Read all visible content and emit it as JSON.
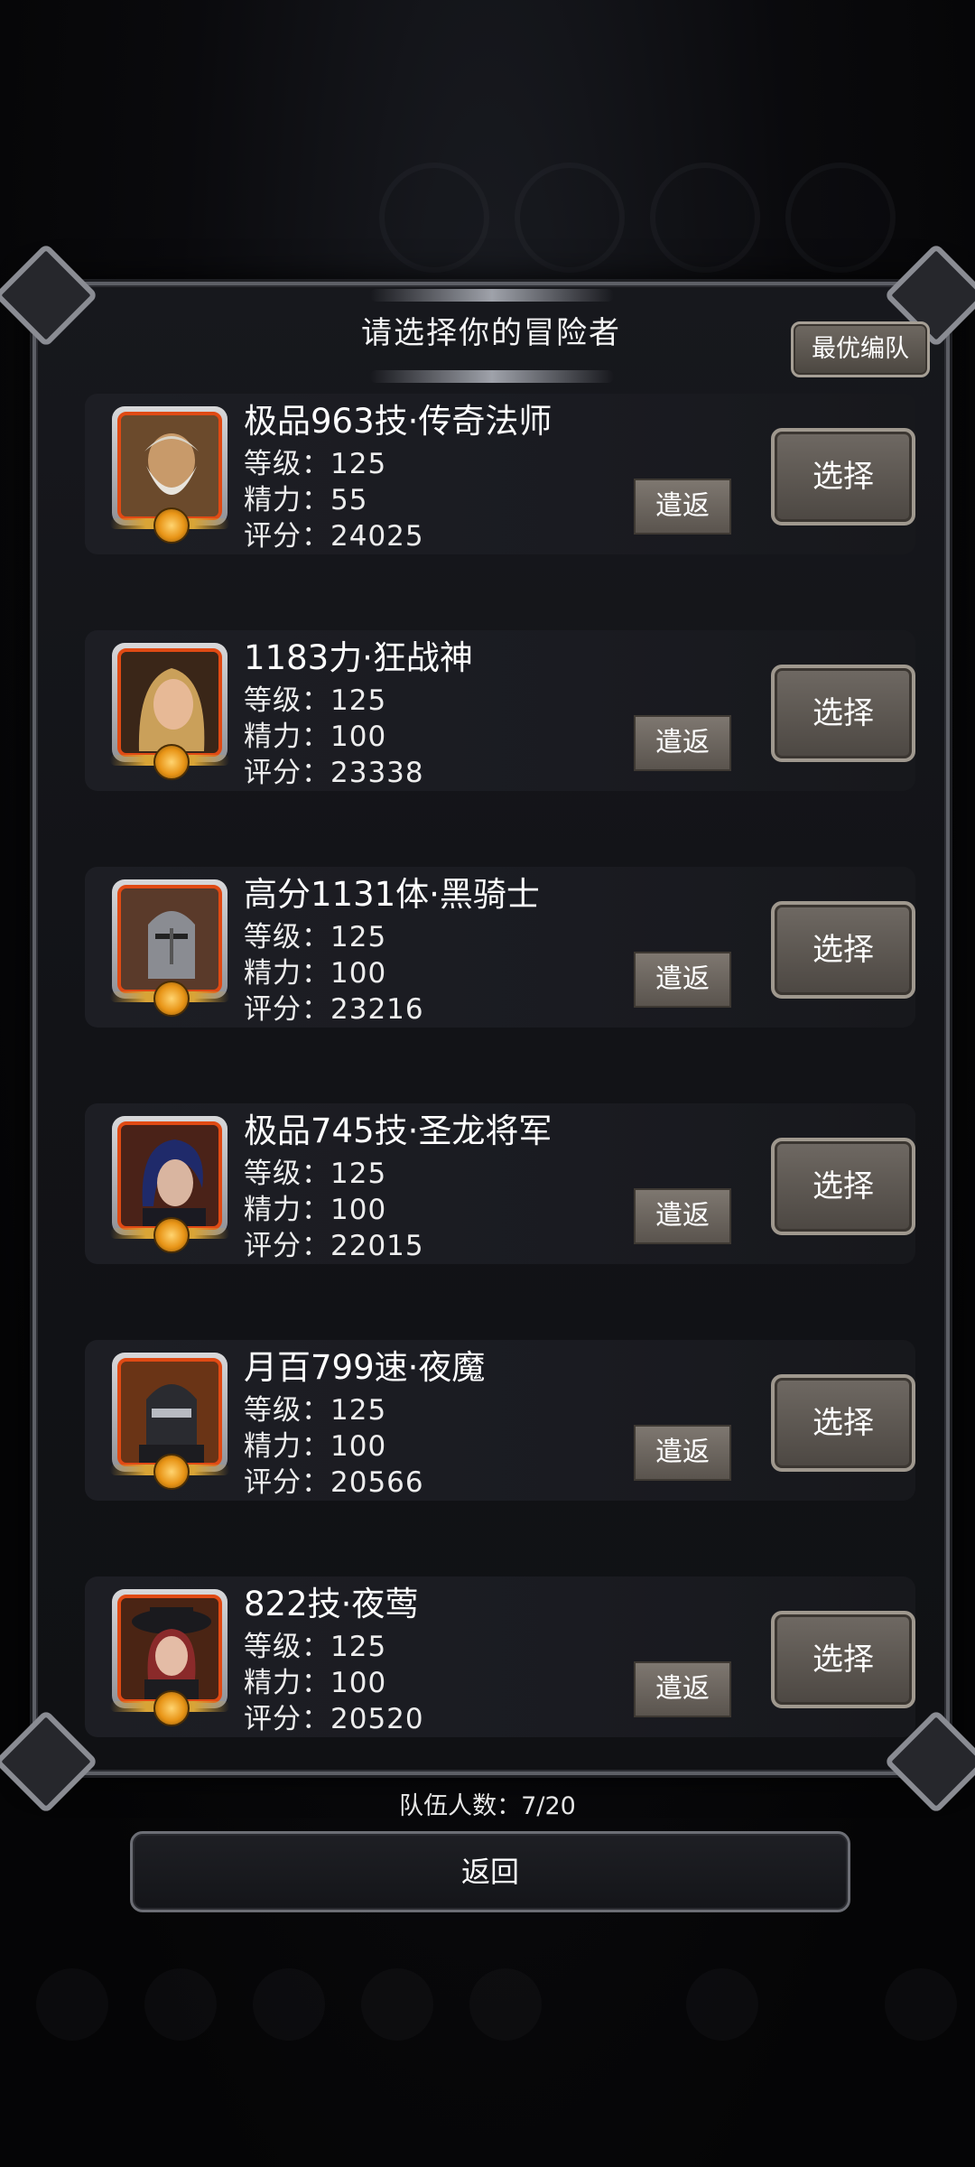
{
  "dialog": {
    "title": "请选择你的冒险者",
    "best_team_label": "最优编队"
  },
  "labels": {
    "level": "等级：",
    "energy": "精力：",
    "score": "评分：",
    "dismiss": "遣返",
    "select": "选择"
  },
  "heroes": [
    {
      "name": "极品963技·传奇法师",
      "level": "125",
      "energy": "55",
      "score": "24025",
      "portrait": "old-wizard-portrait"
    },
    {
      "name": "1183力·狂战神",
      "level": "125",
      "energy": "100",
      "score": "23338",
      "portrait": "blonde-warrior-portrait"
    },
    {
      "name": "高分1131体·黑骑士",
      "level": "125",
      "energy": "100",
      "score": "23216",
      "portrait": "knight-helmet-portrait"
    },
    {
      "name": "极品745技·圣龙将军",
      "level": "125",
      "energy": "100",
      "score": "22015",
      "portrait": "blue-hair-general-portrait"
    },
    {
      "name": "月百799速·夜魔",
      "level": "125",
      "energy": "100",
      "score": "20566",
      "portrait": "masked-assassin-portrait"
    },
    {
      "name": "822技·夜莺",
      "level": "125",
      "energy": "100",
      "score": "20520",
      "portrait": "red-hair-hat-portrait"
    }
  ],
  "footer": {
    "team_count": "队伍人数：7/20",
    "back_label": "返回"
  },
  "colors": {
    "portrait_frame": "#b2320e",
    "button_fill": "#5e5852",
    "dialog_bg": "#121317"
  }
}
